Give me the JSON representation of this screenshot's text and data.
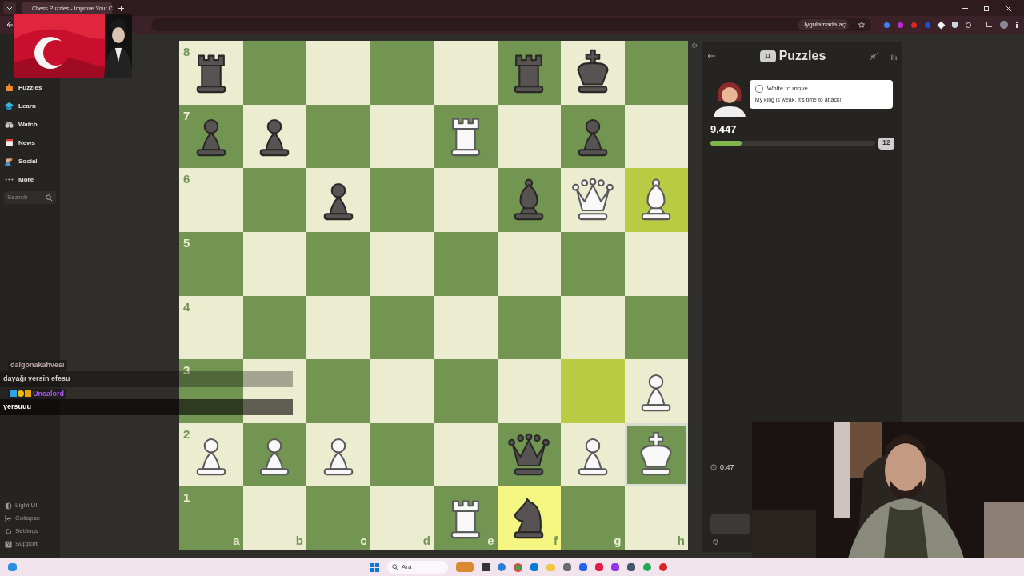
{
  "browser": {
    "tab_title": "Chess Puzzles - Improve Your C",
    "open_in_app": "Uygulamada aç"
  },
  "sidebar": {
    "items": [
      {
        "label": "Puzzles",
        "kind": "puzzle"
      },
      {
        "label": "Learn",
        "kind": "learn"
      },
      {
        "label": "Watch",
        "kind": "watch"
      },
      {
        "label": "News",
        "kind": "news"
      },
      {
        "label": "Social",
        "kind": "social"
      },
      {
        "label": "More",
        "kind": "more"
      }
    ],
    "search": {
      "placeholder": "Search"
    },
    "footer": [
      {
        "label": "Light UI",
        "kind": "theme"
      },
      {
        "label": "Collapse",
        "kind": "collapse"
      },
      {
        "label": "Settings",
        "kind": "settings"
      },
      {
        "label": "Support",
        "kind": "support"
      }
    ]
  },
  "chat": [
    {
      "user": "dalgonakahvesi",
      "color": "#b9a3a6",
      "badges": false,
      "message": "dayağı yersin efesu"
    },
    {
      "user": "Uncalord",
      "color": "#a855f7",
      "badges": true,
      "message": "yersuuu"
    }
  ],
  "board": {
    "rows": [
      {
        "rank": "8",
        "squares": [
          {
            "kind": "rook",
            "white": false,
            "highlighted": false,
            "hovered": false
          },
          {
            "kind": "empty",
            "highlighted": false,
            "hovered": false
          },
          {
            "kind": "empty",
            "highlighted": false,
            "hovered": false
          },
          {
            "kind": "empty",
            "highlighted": false,
            "hovered": false
          },
          {
            "kind": "empty",
            "highlighted": false,
            "hovered": false
          },
          {
            "kind": "rook",
            "white": false,
            "highlighted": false,
            "hovered": false
          },
          {
            "kind": "king",
            "white": false,
            "highlighted": false,
            "hovered": false
          },
          {
            "kind": "empty",
            "highlighted": false,
            "hovered": false
          }
        ]
      },
      {
        "rank": "7",
        "squares": [
          {
            "kind": "pawn",
            "white": false,
            "highlighted": false,
            "hovered": false
          },
          {
            "kind": "pawn",
            "white": false,
            "highlighted": false,
            "hovered": false
          },
          {
            "kind": "empty",
            "highlighted": false,
            "hovered": false
          },
          {
            "kind": "empty",
            "highlighted": false,
            "hovered": false
          },
          {
            "kind": "rook",
            "white": true,
            "highlighted": false,
            "hovered": false
          },
          {
            "kind": "empty",
            "highlighted": false,
            "hovered": false
          },
          {
            "kind": "pawn",
            "white": false,
            "highlighted": false,
            "hovered": false
          },
          {
            "kind": "empty",
            "highlighted": false,
            "hovered": false
          }
        ]
      },
      {
        "rank": "6",
        "squares": [
          {
            "kind": "empty",
            "highlighted": false,
            "hovered": false
          },
          {
            "kind": "empty",
            "highlighted": false,
            "hovered": false
          },
          {
            "kind": "pawn",
            "white": false,
            "highlighted": false,
            "hovered": false
          },
          {
            "kind": "empty",
            "highlighted": false,
            "hovered": false
          },
          {
            "kind": "empty",
            "highlighted": false,
            "hovered": false
          },
          {
            "kind": "bishop",
            "white": false,
            "highlighted": false,
            "hovered": false
          },
          {
            "kind": "queen",
            "white": true,
            "highlighted": false,
            "hovered": false
          },
          {
            "kind": "bishop",
            "white": true,
            "highlighted": true,
            "hovered": false
          }
        ]
      },
      {
        "rank": "5",
        "squares": [
          {
            "kind": "empty",
            "highlighted": false,
            "hovered": false
          },
          {
            "kind": "empty",
            "highlighted": false,
            "hovered": false
          },
          {
            "kind": "empty",
            "highlighted": false,
            "hovered": false
          },
          {
            "kind": "empty",
            "highlighted": false,
            "hovered": false
          },
          {
            "kind": "empty",
            "highlighted": false,
            "hovered": false
          },
          {
            "kind": "empty",
            "highlighted": false,
            "hovered": false
          },
          {
            "kind": "empty",
            "highlighted": false,
            "hovered": false
          },
          {
            "kind": "empty",
            "highlighted": false,
            "hovered": false
          }
        ]
      },
      {
        "rank": "4",
        "squares": [
          {
            "kind": "empty",
            "highlighted": false,
            "hovered": false
          },
          {
            "kind": "empty",
            "highlighted": false,
            "hovered": false
          },
          {
            "kind": "empty",
            "highlighted": false,
            "hovered": false
          },
          {
            "kind": "empty",
            "highlighted": false,
            "hovered": false
          },
          {
            "kind": "empty",
            "highlighted": false,
            "hovered": false
          },
          {
            "kind": "empty",
            "highlighted": false,
            "hovered": false
          },
          {
            "kind": "empty",
            "highlighted": false,
            "hovered": false
          },
          {
            "kind": "empty",
            "highlighted": false,
            "hovered": false
          }
        ]
      },
      {
        "rank": "3",
        "squares": [
          {
            "kind": "empty",
            "highlighted": false,
            "hovered": false
          },
          {
            "kind": "empty",
            "highlighted": false,
            "hovered": false
          },
          {
            "kind": "empty",
            "highlighted": false,
            "hovered": false
          },
          {
            "kind": "empty",
            "highlighted": false,
            "hovered": false
          },
          {
            "kind": "empty",
            "highlighted": false,
            "hovered": false
          },
          {
            "kind": "empty",
            "highlighted": false,
            "hovered": false
          },
          {
            "kind": "empty",
            "highlighted": true,
            "hovered": false
          },
          {
            "kind": "pawn",
            "white": true,
            "highlighted": false,
            "hovered": false
          }
        ]
      },
      {
        "rank": "2",
        "squares": [
          {
            "kind": "pawn",
            "white": true,
            "highlighted": false,
            "hovered": false
          },
          {
            "kind": "pawn",
            "white": true,
            "highlighted": false,
            "hovered": false
          },
          {
            "kind": "pawn",
            "white": true,
            "highlighted": false,
            "hovered": false
          },
          {
            "kind": "empty",
            "highlighted": false,
            "hovered": false
          },
          {
            "kind": "empty",
            "highlighted": false,
            "hovered": false
          },
          {
            "kind": "queen",
            "white": false,
            "highlighted": false,
            "hovered": false
          },
          {
            "kind": "pawn",
            "white": true,
            "highlighted": false,
            "hovered": false
          },
          {
            "kind": "king",
            "white": true,
            "highlighted": false,
            "hovered": true
          }
        ]
      },
      {
        "rank": "1",
        "squares": [
          {
            "kind": "empty",
            "highlighted": false,
            "hovered": false
          },
          {
            "kind": "empty",
            "highlighted": false,
            "hovered": false
          },
          {
            "kind": "empty",
            "highlighted": false,
            "hovered": false
          },
          {
            "kind": "empty",
            "highlighted": false,
            "hovered": false
          },
          {
            "kind": "rook",
            "white": true,
            "highlighted": false,
            "hovered": false
          },
          {
            "kind": "knight",
            "white": false,
            "highlighted": true,
            "hovered": false
          },
          {
            "kind": "empty",
            "highlighted": false,
            "hovered": false
          },
          {
            "kind": "empty",
            "highlighted": false,
            "hovered": false
          }
        ]
      }
    ],
    "files": [
      "a",
      "b",
      "c",
      "d",
      "e",
      "f",
      "g",
      "h"
    ]
  },
  "panel": {
    "title": "Puzzles",
    "title_badge": "11",
    "prompt": {
      "checked": false,
      "text": "White to move"
    },
    "coach_message": "My king is weak. It's time to attack!",
    "score": "9,447",
    "progress": {
      "level": 0.19
    },
    "next_badge": "12",
    "timer": "0:47"
  },
  "taskbar": {
    "search_placeholder": "Ara"
  }
}
